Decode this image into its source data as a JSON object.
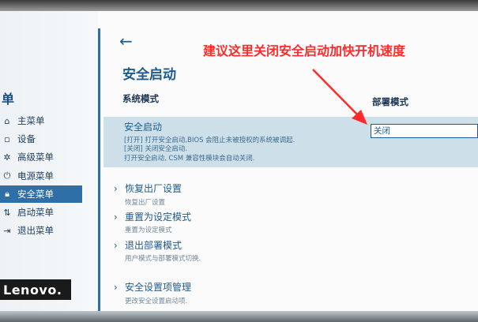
{
  "sidebar": {
    "title": "单",
    "items": [
      {
        "label": "主菜单",
        "icon": "home-icon"
      },
      {
        "label": "设备",
        "icon": "device-icon"
      },
      {
        "label": "高级菜单",
        "icon": "advanced-icon"
      },
      {
        "label": "电源菜单",
        "icon": "power-icon"
      },
      {
        "label": "安全菜单",
        "icon": "lock-icon",
        "selected": true
      },
      {
        "label": "启动菜单",
        "icon": "boot-icon"
      },
      {
        "label": "退出菜单",
        "icon": "exit-icon"
      }
    ],
    "brand": "Lenovo."
  },
  "main": {
    "back_icon": "arrow-left-icon",
    "page_title": "安全启动",
    "system_mode_label": "系统模式",
    "deploy_mode_label": "部署模式",
    "secure_boot": {
      "title": "安全启动",
      "desc_lines": [
        "[打开] 打开安全启动,BIOS 会阻止未被授权的系统被调起.",
        "[关闭] 关闭安全启动.",
        "打开安全启动, CSM 兼容性模块会自动关闭."
      ],
      "value": "关闭"
    },
    "options": [
      {
        "title": "恢复出厂设置",
        "desc": "恢复出厂设置"
      },
      {
        "title": "重置为设定模式",
        "desc": "重置为设定模式"
      },
      {
        "title": "退出部署模式",
        "desc": "用户模式与部署模式切换."
      },
      {
        "title": "安全设置项管理",
        "desc": "更改安全设置启动项."
      }
    ]
  },
  "annotation": {
    "text": "建议这里关闭安全启动加快开机速度",
    "color": "#ff2b2b"
  },
  "colors": {
    "accent": "#2f6fa8",
    "highlight": "#cde0ea",
    "text_blue": "#1e5b8c"
  }
}
